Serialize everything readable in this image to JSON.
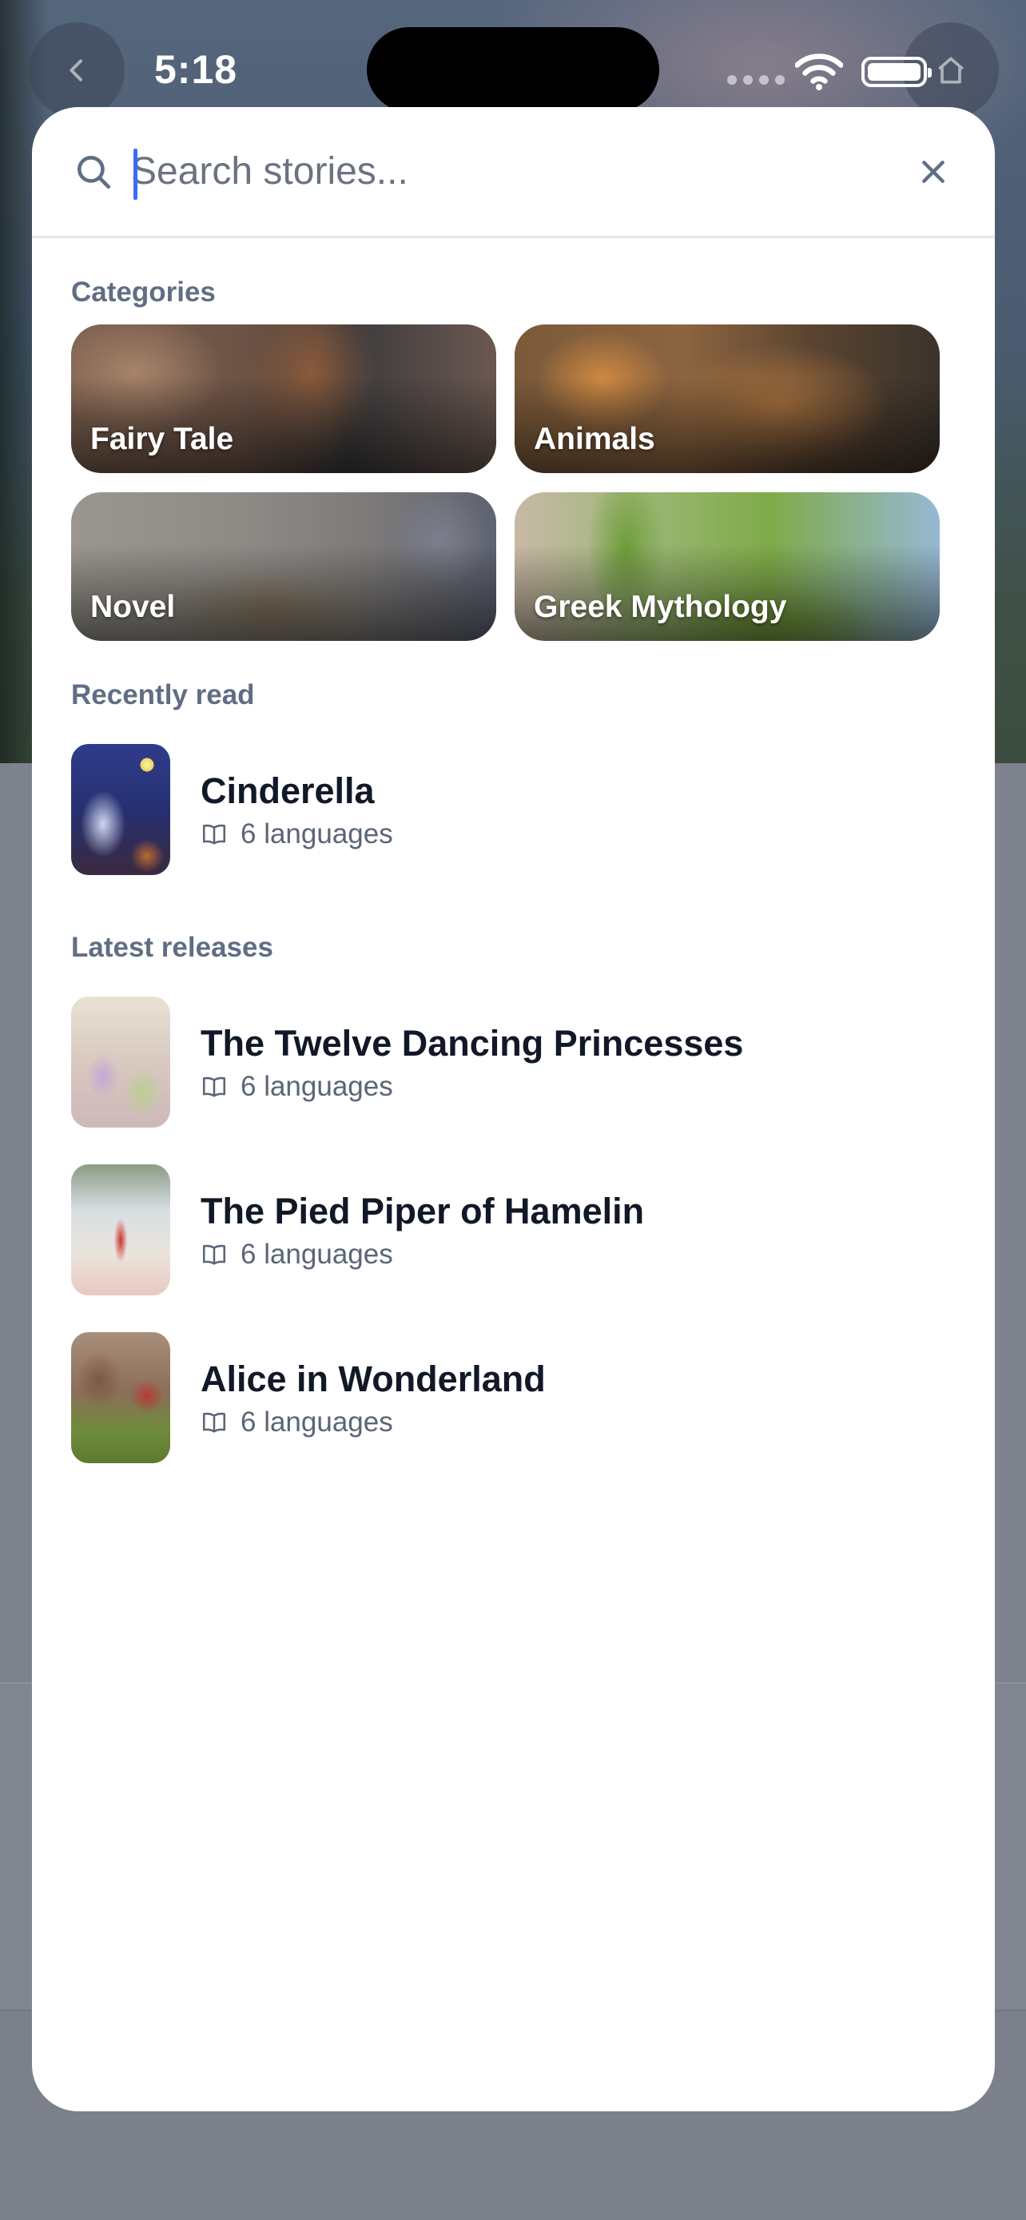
{
  "status_bar": {
    "time": "5:18"
  },
  "search": {
    "placeholder": "Search stories..."
  },
  "categories": {
    "title": "Categories",
    "items": [
      {
        "label": "Fairy Tale"
      },
      {
        "label": "Animals"
      },
      {
        "label": "Novel"
      },
      {
        "label": "Greek Mythology"
      }
    ]
  },
  "recently_read": {
    "title": "Recently read",
    "items": [
      {
        "title": "Cinderella",
        "meta": "6 languages"
      }
    ]
  },
  "latest_releases": {
    "title": "Latest releases",
    "items": [
      {
        "title": "The Twelve Dancing Princesses",
        "meta": "6 languages"
      },
      {
        "title": "The Pied Piper of Hamelin",
        "meta": "6 languages"
      },
      {
        "title": "Alice in Wonderland",
        "meta": "6 languages"
      }
    ]
  },
  "colors": {
    "accent": "#3b6cf5",
    "section_title": "#5f6e83",
    "text_primary": "#111827",
    "text_secondary": "#5a6676"
  },
  "icons": [
    "search-icon",
    "close-icon",
    "book-icon",
    "wifi-icon",
    "battery-icon",
    "back-arrow-icon",
    "home-icon"
  ]
}
